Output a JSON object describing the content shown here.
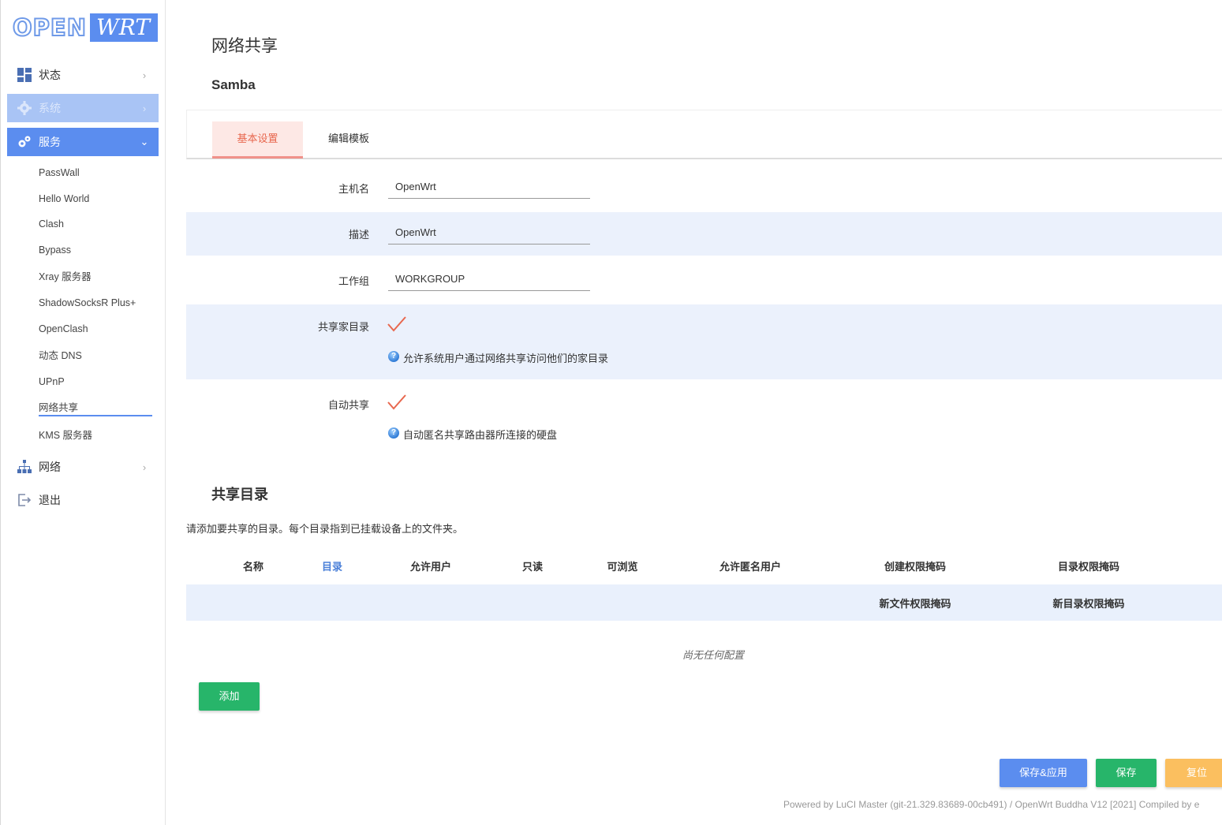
{
  "logo": {
    "open": "OPEN",
    "wrt": "WRT"
  },
  "nav": {
    "status": {
      "label": "状态",
      "icon": "dashboard-icon"
    },
    "system": {
      "label": "系统",
      "icon": "gear-icon"
    },
    "services": {
      "label": "服务",
      "icon": "gears-icon"
    },
    "network": {
      "label": "网络",
      "icon": "sitemap-icon"
    },
    "logout": {
      "label": "退出",
      "icon": "sign-out-icon"
    }
  },
  "services_menu": [
    "PassWall",
    "Hello World",
    "Clash",
    "Bypass",
    "Xray 服务器",
    "ShadowSocksR Plus+",
    "OpenClash",
    "动态 DNS",
    "UPnP",
    "网络共享",
    "KMS 服务器"
  ],
  "page": {
    "title": "网络共享",
    "section": "Samba"
  },
  "tabs": {
    "basic": "基本设置",
    "template": "编辑模板"
  },
  "form": {
    "hostname": {
      "label": "主机名",
      "value": "OpenWrt"
    },
    "description": {
      "label": "描述",
      "value": "OpenWrt"
    },
    "workgroup": {
      "label": "工作组",
      "value": "WORKGROUP"
    },
    "share_home": {
      "label": "共享家目录",
      "checked": true,
      "hint": "允许系统用户通过网络共享访问他们的家目录"
    },
    "auto_share": {
      "label": "自动共享",
      "checked": true,
      "hint": "自动匿名共享路由器所连接的硬盘"
    }
  },
  "shares": {
    "title": "共享目录",
    "description": "请添加要共享的目录。每个目录指到已挂载设备上的文件夹。",
    "columns": [
      "名称",
      "目录",
      "允许用户",
      "只读",
      "可浏览",
      "允许匿名用户",
      "创建权限掩码",
      "目录权限掩码"
    ],
    "columns_row2": [
      "新文件权限掩码",
      "新目录权限掩码"
    ],
    "empty": "尚无任何配置",
    "add_label": "添加"
  },
  "actions": {
    "save_apply": "保存&应用",
    "save": "保存",
    "reset": "复位"
  },
  "footer": "Powered by LuCI Master (git-21.329.83689-00cb491) / OpenWrt Buddha V12 [2021] Compiled by e",
  "colors": {
    "accent": "#5b8def",
    "green": "#27b56a",
    "orange": "#fbbf5f",
    "check": "#e8684f"
  }
}
